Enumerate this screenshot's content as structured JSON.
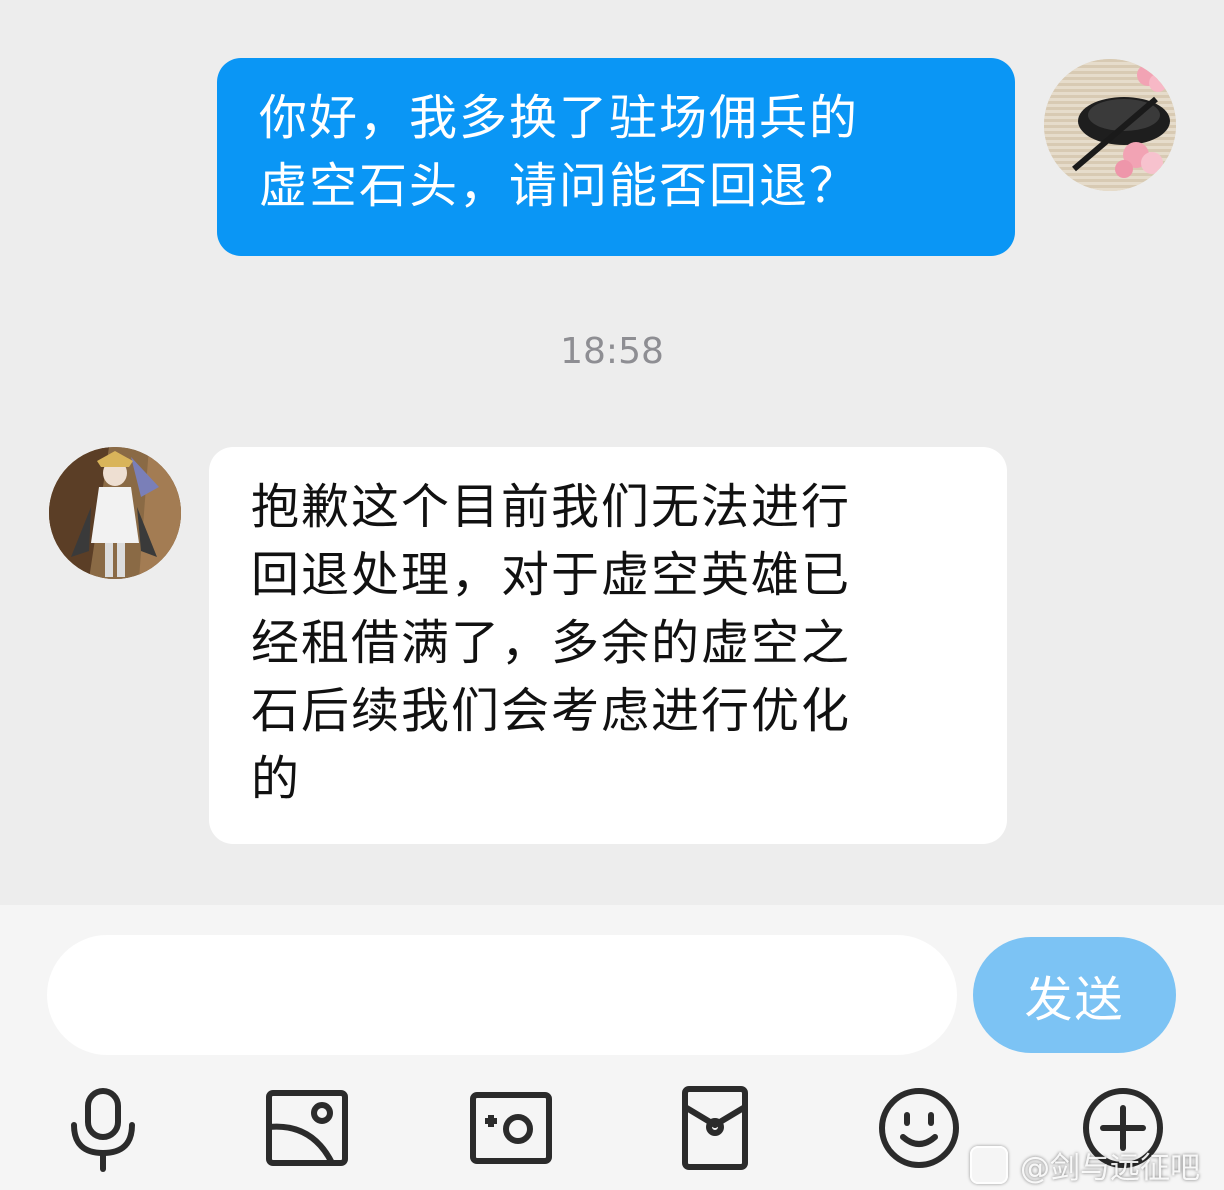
{
  "messages": [
    {
      "direction": "outgoing",
      "text": "你好，我多换了驻场佣兵的\n虚空石头，请问能否回退？"
    },
    {
      "direction": "incoming",
      "text": "抱歉这个目前我们无法进行\n回退处理，对于虚空英雄已\n经租借满了，多余的虚空之\n石后续我们会考虑进行优化\n的"
    }
  ],
  "timestamp": "18:58",
  "input": {
    "value": "",
    "placeholder": ""
  },
  "send_label": "发送",
  "toolbar": [
    {
      "icon": "microphone-icon"
    },
    {
      "icon": "image-icon"
    },
    {
      "icon": "camera-icon"
    },
    {
      "icon": "red-packet-icon"
    },
    {
      "icon": "emoji-icon"
    },
    {
      "icon": "plus-icon"
    }
  ],
  "watermark": "@剑与远征吧",
  "colors": {
    "outgoing_bubble": "#0a96f5",
    "incoming_bubble": "#ffffff",
    "send_button": "#7cc3f4",
    "background": "#ededed"
  }
}
